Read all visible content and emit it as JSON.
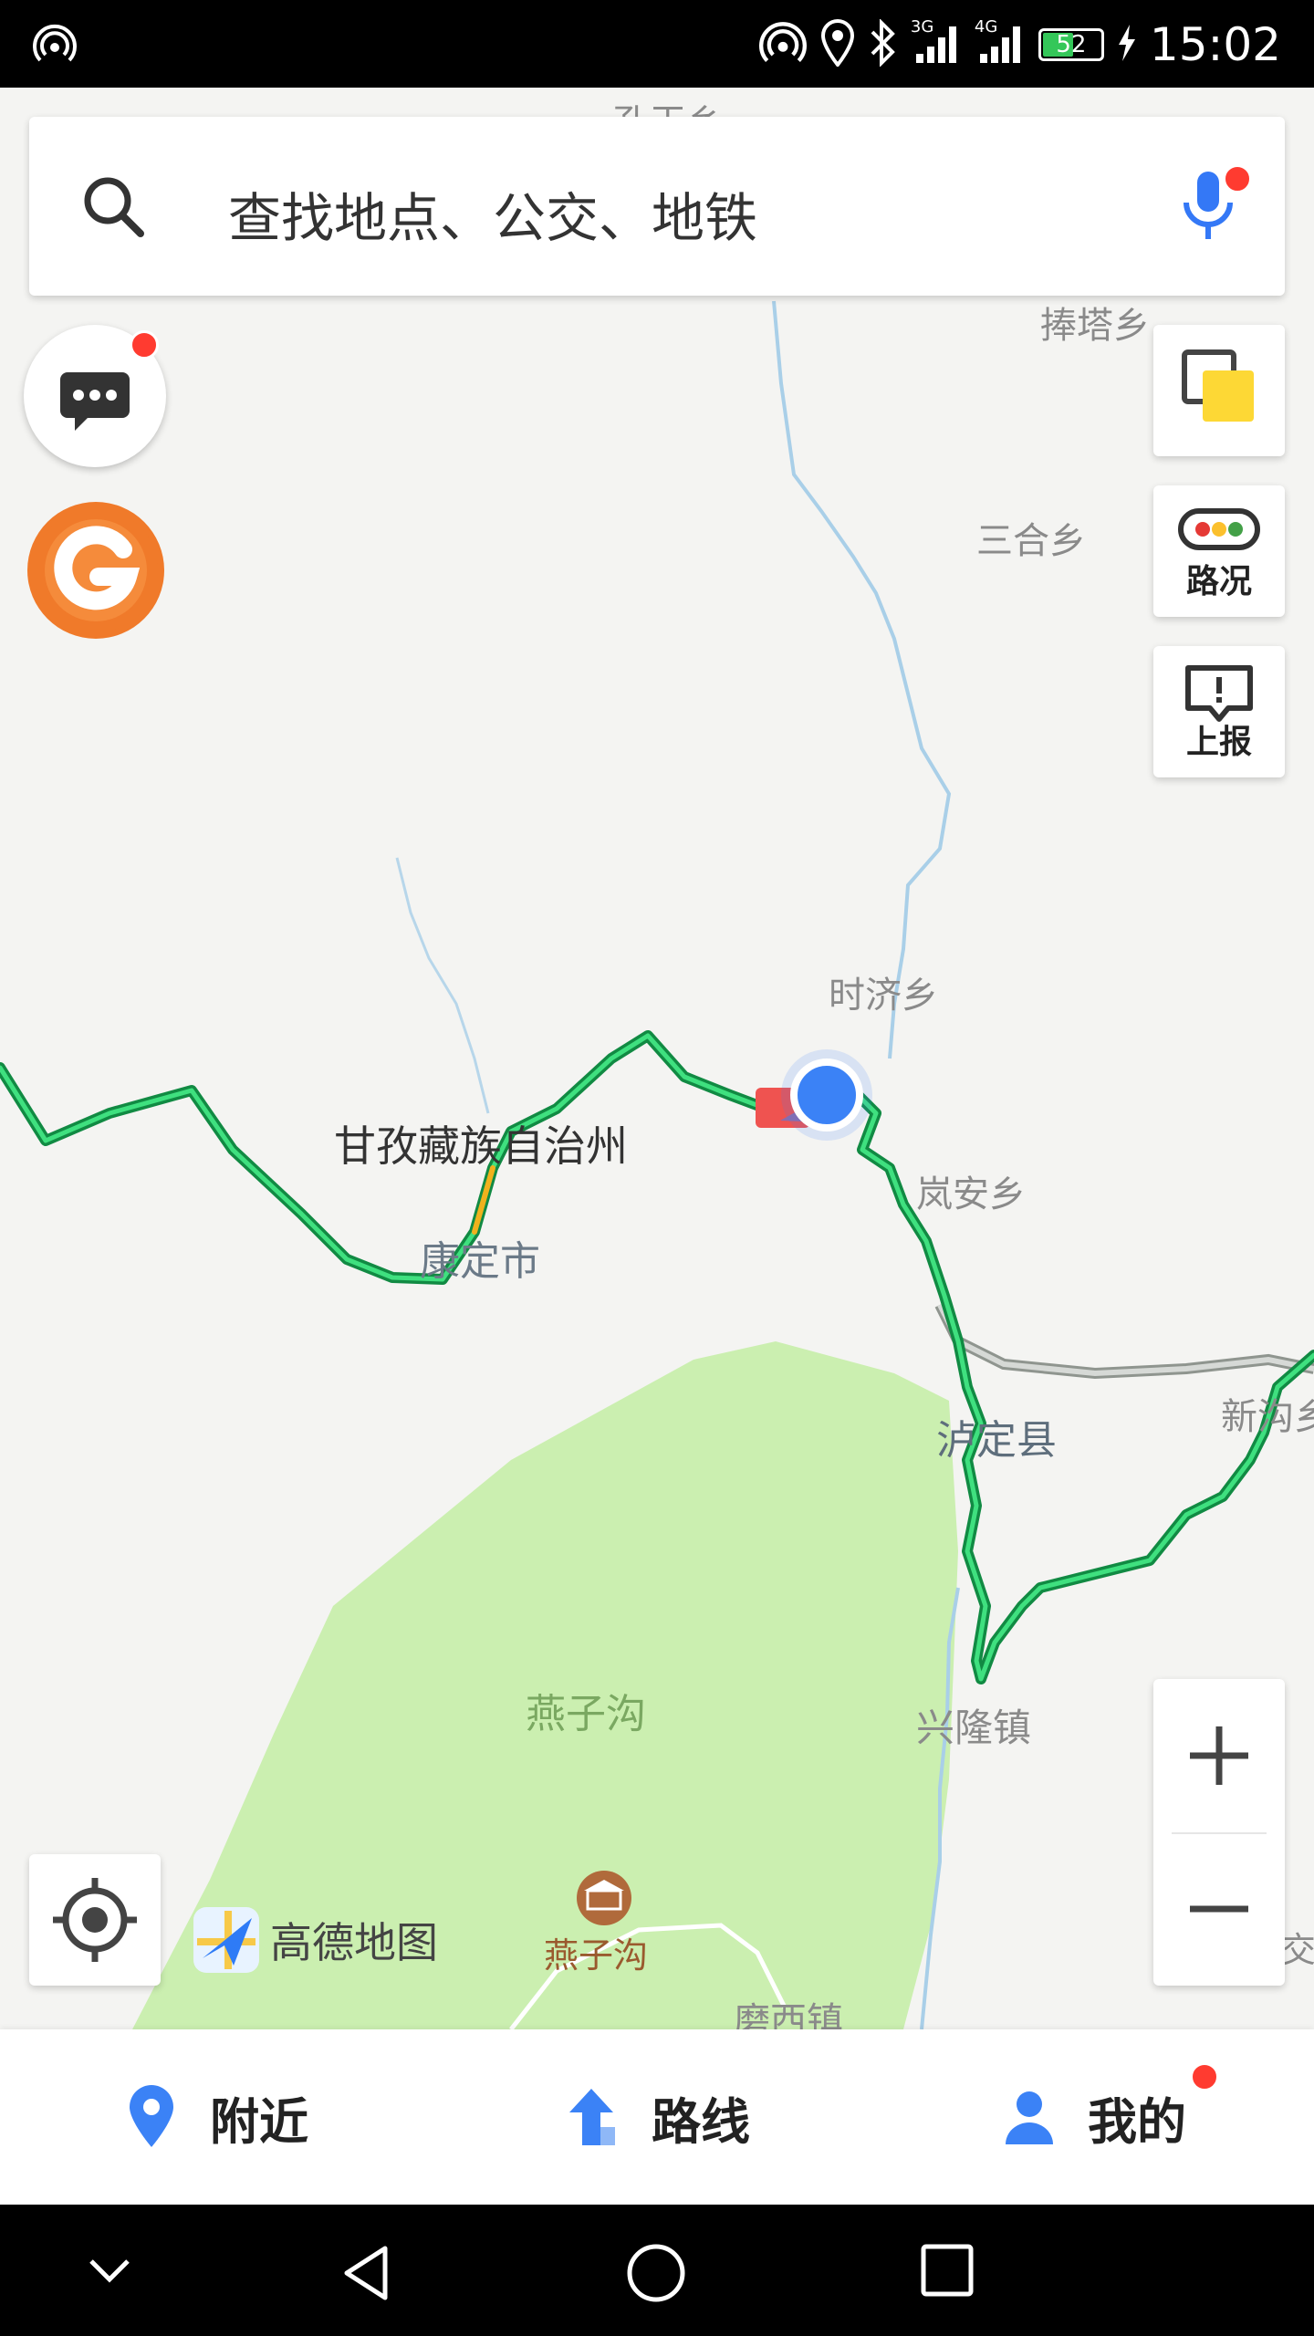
{
  "status_bar": {
    "time": "15:02",
    "battery": "52",
    "network_3g": "3G",
    "network_4g": "4G"
  },
  "search": {
    "placeholder": "查找地点、公交、地铁"
  },
  "tools": {
    "traffic_label": "路况",
    "report_label": "上报"
  },
  "logo": {
    "text": "高德地图"
  },
  "map": {
    "labels": {
      "top_partial": "孔玉乡",
      "pengta": "捧塔乡",
      "sanhe": "三合乡",
      "shiji": "时济乡",
      "ganzi": "甘孜藏族自治州",
      "kangding": "康定市",
      "lanan": "岚安乡",
      "luding": "泸定县",
      "xingou": "新沟乡",
      "yanzigou_area": "燕子沟",
      "xinglong": "兴隆镇",
      "yanzigou_poi": "燕子沟",
      "moxi": "磨西镇",
      "right_partial": "交"
    },
    "colors": {
      "land": "#f4f4f2",
      "park": "#cbefb0",
      "river": "#a9cfe8",
      "road_green": "#2bc36b",
      "highway": "#a6aaa6",
      "location": "#3b82f6"
    }
  },
  "bottom_nav": {
    "nearby": "附近",
    "route": "路线",
    "mine": "我的"
  }
}
